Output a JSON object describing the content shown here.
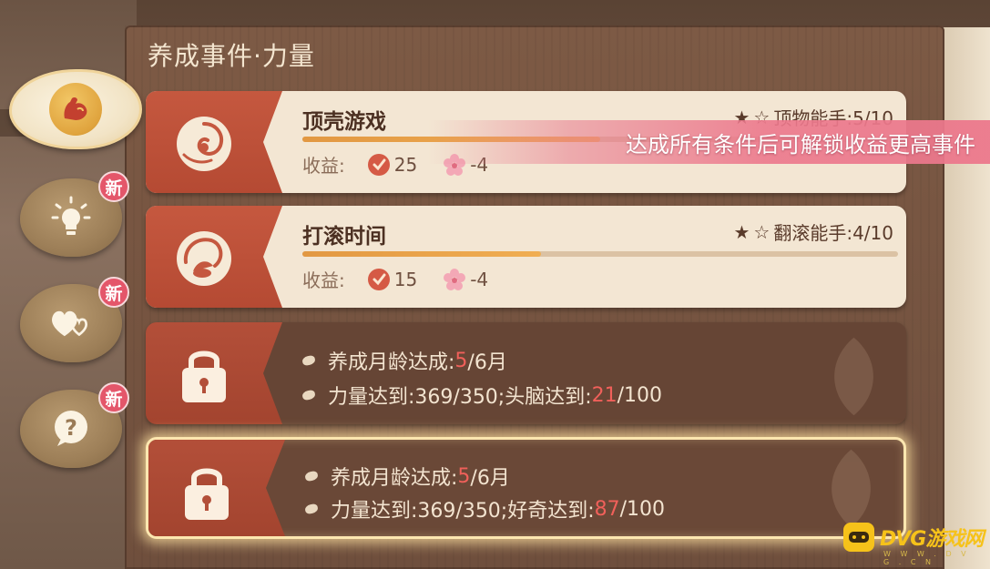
{
  "panel": {
    "title": "养成事件·力量"
  },
  "tabs": [
    {
      "id": "strength",
      "icon": "muscle-arm-icon",
      "active": true,
      "new_badge": ""
    },
    {
      "id": "idea",
      "icon": "lightbulb-icon",
      "active": false,
      "new_badge": "新"
    },
    {
      "id": "affection",
      "icon": "hearts-icon",
      "active": false,
      "new_badge": "新"
    },
    {
      "id": "curiosity",
      "icon": "question-bubble-icon",
      "active": false,
      "new_badge": "新"
    }
  ],
  "events": [
    {
      "title": "顶壳游戏",
      "stars": "顶物能手:5/10",
      "progress": 0.5,
      "yield_label": "收益:",
      "yield_main": "25",
      "yield_sakura": "-4"
    },
    {
      "title": "打滚时间",
      "stars": "翻滚能手:4/10",
      "progress": 0.4,
      "yield_label": "收益:",
      "yield_main": "15",
      "yield_sakura": "-4"
    }
  ],
  "locked_events": [
    {
      "line1_label": "养成月龄达成:",
      "line1_current": "5",
      "line1_total": "/6月",
      "line2_label": "力量达到:369/350;头脑达到:",
      "line2_current": "21",
      "line2_total": "/100"
    },
    {
      "line1_label": "养成月龄达成:",
      "line1_current": "5",
      "line1_total": "/6月",
      "line2_label": "力量达到:369/350;好奇达到:",
      "line2_current": "87",
      "line2_total": "/100"
    }
  ],
  "toast": "达成所有条件后可解锁收益更高事件",
  "watermark": {
    "brand": "DVG游戏网",
    "sub": "W W W . D V G . C N"
  },
  "colors": {
    "accent_red": "#c5583f",
    "progress": "#e29842",
    "red_value": "#f0605a",
    "toast": "#ec788c"
  }
}
